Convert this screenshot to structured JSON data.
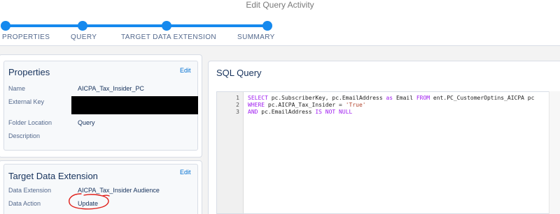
{
  "window": {
    "title": "Edit Query Activity"
  },
  "wizard": {
    "steps": [
      {
        "label": "PROPERTIES"
      },
      {
        "label": "QUERY"
      },
      {
        "label": "TARGET DATA EXTENSION"
      },
      {
        "label": "SUMMARY"
      }
    ]
  },
  "properties": {
    "title": "Properties",
    "edit_label": "Edit",
    "fields": [
      {
        "label": "Name",
        "value": "AICPA_Tax_Insider_PC"
      },
      {
        "label": "External Key",
        "value": ""
      },
      {
        "label": "Folder Location",
        "value": "Query"
      },
      {
        "label": "Description",
        "value": ""
      }
    ]
  },
  "target": {
    "title": "Target Data Extension",
    "edit_label": "Edit",
    "fields": [
      {
        "label": "Data Extension",
        "value": "AICPA_Tax_Insider Audience"
      },
      {
        "label": "Data Action",
        "value": "Update"
      }
    ]
  },
  "sql": {
    "title": "SQL Query",
    "lines": [
      {
        "num": "1",
        "parts": [
          {
            "t": "SELECT",
            "k": "kw"
          },
          {
            "t": " pc.SubscriberKey, pc.EmailAddress ",
            "k": ""
          },
          {
            "t": "as",
            "k": "kw"
          },
          {
            "t": " Email ",
            "k": ""
          },
          {
            "t": "FROM",
            "k": "kw"
          },
          {
            "t": " ent.PC_CustomerOptins_AICPA pc",
            "k": ""
          }
        ]
      },
      {
        "num": "2",
        "parts": [
          {
            "t": "WHERE",
            "k": "kw"
          },
          {
            "t": " pc.AICPA_Tax_Insider = ",
            "k": ""
          },
          {
            "t": "'True'",
            "k": "str"
          }
        ]
      },
      {
        "num": "3",
        "parts": [
          {
            "t": "AND",
            "k": "kw"
          },
          {
            "t": " pc.EmailAddress ",
            "k": ""
          },
          {
            "t": "IS NOT NULL",
            "k": "kw"
          }
        ]
      }
    ]
  },
  "colors": {
    "accent": "#1589ee",
    "link": "#0070d2",
    "annotation": "#e0201b",
    "keyword": "#a020f0",
    "string": "#b2452e"
  }
}
